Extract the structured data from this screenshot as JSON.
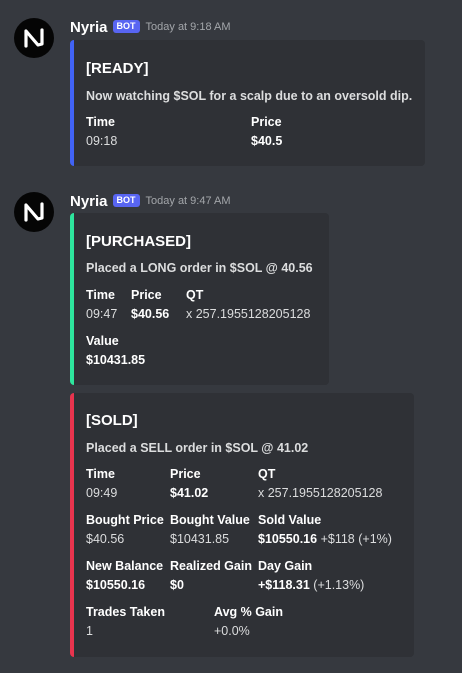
{
  "colors": {
    "background": "#36393f",
    "embed_bg": "#2f3136",
    "ready_bar": "#4163f5",
    "purchased_bar": "#2ee59d",
    "sold_bar": "#e8344e",
    "bot_badge": "#5865f2"
  },
  "avatar_icon": "nyria-logo-icon",
  "messages": [
    {
      "username": "Nyria",
      "badge": "BOT",
      "timestamp": "Today at 9:18 AM",
      "embeds": [
        {
          "title": "[READY]",
          "description": "Now watching $SOL for a scalp due to an oversold dip.",
          "fields": {
            "time": {
              "name": "Time",
              "value": "09:18"
            },
            "price": {
              "name": "Price",
              "value": "$40.5"
            }
          }
        }
      ]
    },
    {
      "username": "Nyria",
      "badge": "BOT",
      "timestamp": "Today at 9:47 AM",
      "embeds": [
        {
          "title": "[PURCHASED]",
          "description": "Placed a LONG order in $SOL @ 40.56",
          "fields": {
            "time": {
              "name": "Time",
              "value": "09:47"
            },
            "price": {
              "name": "Price",
              "value": "$40.56"
            },
            "qt": {
              "name": "QT",
              "value": "x 257.1955128205128"
            },
            "value": {
              "name": "Value",
              "value": "$10431.85"
            }
          }
        },
        {
          "title": "[SOLD]",
          "description": "Placed a SELL order in $SOL @ 41.02",
          "fields": {
            "time": {
              "name": "Time",
              "value": "09:49"
            },
            "price": {
              "name": "Price",
              "value": "$41.02"
            },
            "qt": {
              "name": "QT",
              "value": "x 257.1955128205128"
            },
            "bought_price": {
              "name": "Bought Price",
              "value": "$40.56"
            },
            "bought_value": {
              "name": "Bought Value",
              "value": "$10431.85"
            },
            "sold_value": {
              "name": "Sold Value",
              "value": "$10550.16",
              "extra": "+$118 (+1%)"
            },
            "new_balance": {
              "name": "New Balance",
              "value": "$10550.16"
            },
            "realized_gain": {
              "name": "Realized Gain",
              "value": "$0"
            },
            "day_gain": {
              "name": "Day Gain",
              "value": "+$118.31",
              "extra": "(+1.13%)"
            },
            "trades_taken": {
              "name": "Trades Taken",
              "value": "1"
            },
            "avg_gain": {
              "name": "Avg % Gain",
              "value": "+0.0%"
            }
          }
        }
      ]
    }
  ]
}
